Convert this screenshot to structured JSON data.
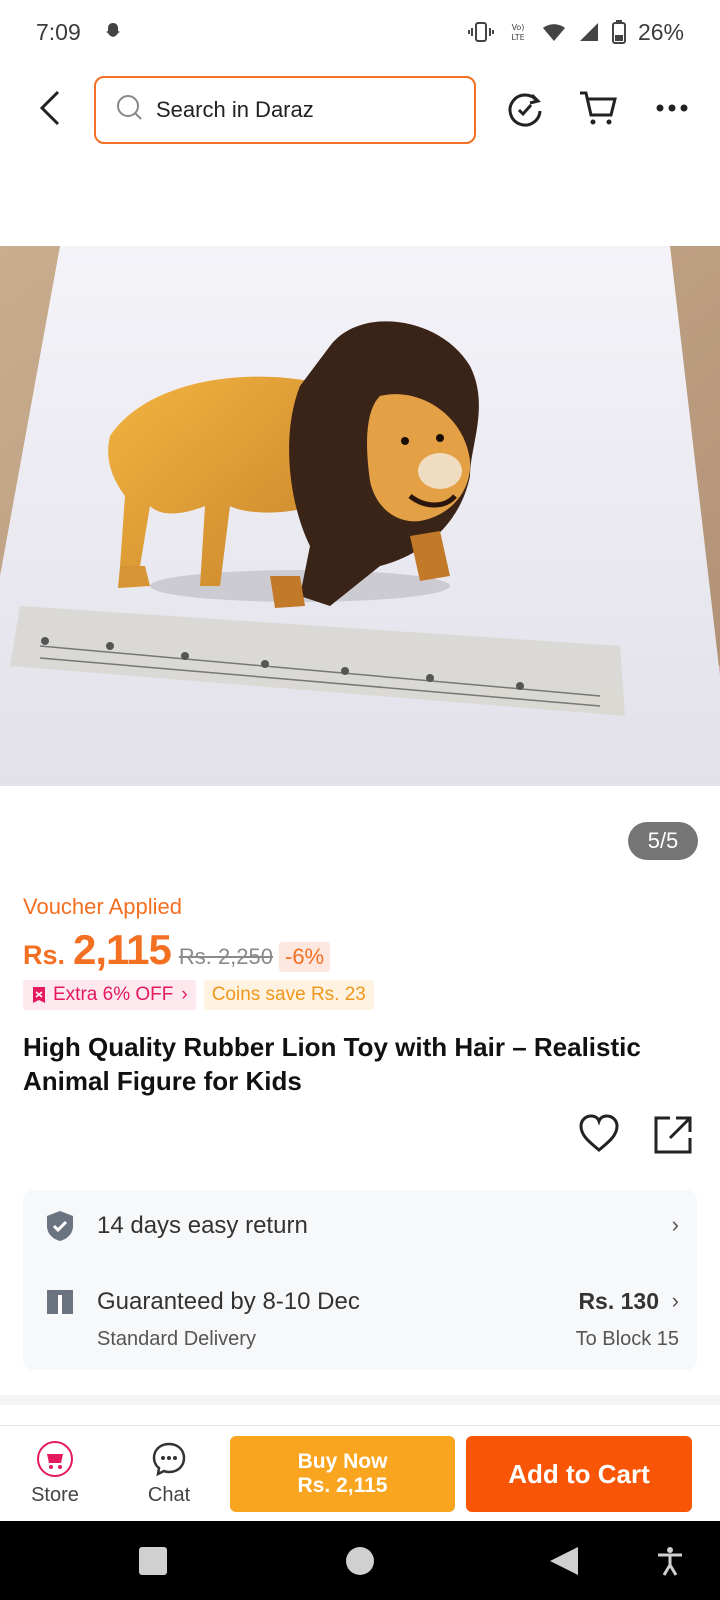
{
  "status_bar": {
    "time": "7:09",
    "battery": "26%",
    "icons": [
      "snapchat-icon",
      "vibrate-icon",
      "volte-icon",
      "wifi-icon",
      "signal-icon",
      "battery-icon"
    ]
  },
  "top_nav": {
    "search_placeholder": "Search in Daraz",
    "icons": [
      "back-arrow-icon",
      "search-icon",
      "refresh-icon",
      "cart-icon",
      "more-icon"
    ]
  },
  "gallery": {
    "counter": "5/5"
  },
  "product": {
    "voucher_label": "Voucher Applied",
    "currency": "Rs.",
    "price": "2,115",
    "old_price": "Rs. 2,250",
    "discount": "-6%",
    "extra_off": "Extra 6% OFF",
    "coins_save": "Coins save Rs. 23",
    "title": "High Quality Rubber Lion Toy with Hair – Realistic Animal Figure for Kids"
  },
  "services": {
    "return_text": "14 days easy return",
    "delivery_text": "Guaranteed by 8-10 Dec",
    "delivery_sub": "Standard Delivery",
    "delivery_price": "Rs. 130",
    "delivery_location": "To Block 15"
  },
  "action_bar": {
    "store_label": "Store",
    "chat_label": "Chat",
    "buy_now_label": "Buy Now",
    "buy_now_price": "Rs. 2,115",
    "add_to_cart_label": "Add to Cart"
  },
  "colors": {
    "accent": "#f36f21",
    "buy_now": "#f9a51f",
    "add_to_cart": "#f85606",
    "extra_tag": "#e5195e",
    "coins_tag": "#f0971d"
  }
}
